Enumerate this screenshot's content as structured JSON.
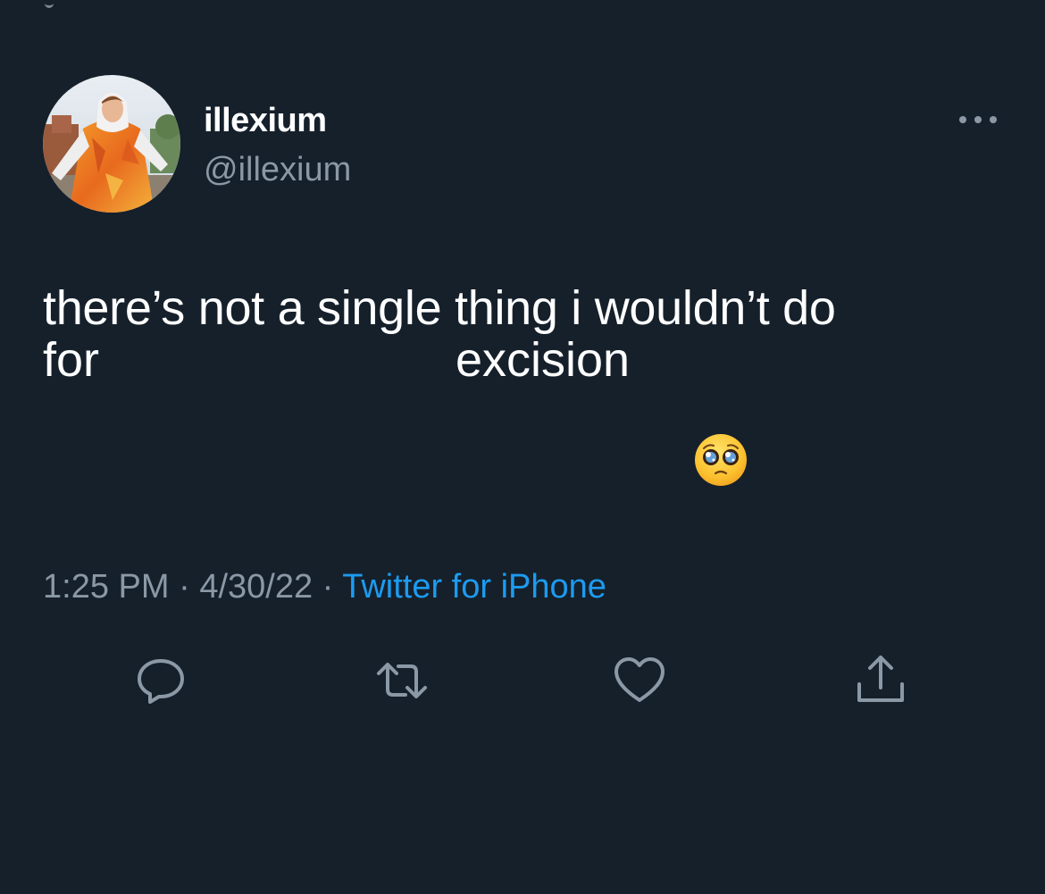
{
  "author": {
    "display_name": "illexium",
    "handle": "@illexium",
    "avatar": "profile-photo"
  },
  "tweet": {
    "line1": "there’s not a single thing i wouldn’t do",
    "line2_start": "for",
    "line2_end": "excision",
    "emoji": "pleading-face"
  },
  "meta": {
    "time": "1:25 PM",
    "separator1": " · ",
    "date": "4/30/22",
    "separator2": " · ",
    "source": "Twitter for iPhone"
  },
  "actions": [
    {
      "icon": "reply-icon"
    },
    {
      "icon": "retweet-icon"
    },
    {
      "icon": "like-icon"
    },
    {
      "icon": "share-icon"
    }
  ],
  "colors": {
    "background": "#15202b",
    "text": "#ffffff",
    "secondary_text": "#8b98a5",
    "link": "#1d9bf0"
  }
}
